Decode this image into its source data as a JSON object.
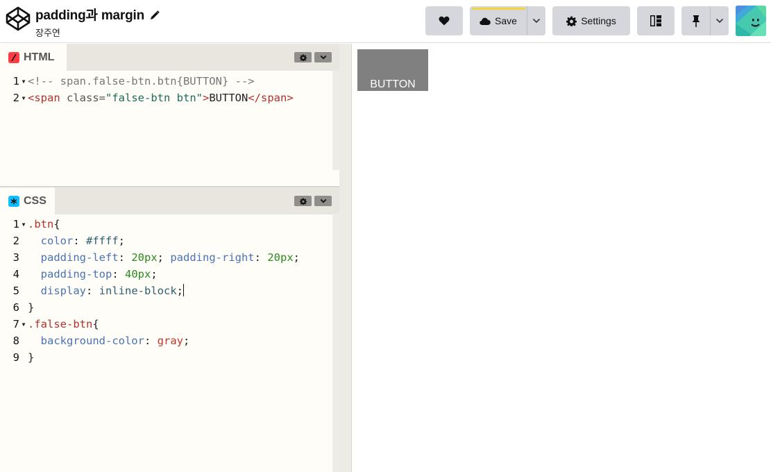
{
  "header": {
    "pen_title": "padding과 margin",
    "author": "장주연",
    "save_label": "Save",
    "settings_label": "Settings"
  },
  "html_pane": {
    "tab_label": "HTML",
    "lines": [
      {
        "num": "1",
        "fold": true,
        "parts": [
          {
            "t": "<!-- span.false-btn.btn{BUTTON} -->",
            "c": "c-comment"
          }
        ]
      },
      {
        "num": "2",
        "fold": true,
        "parts": [
          {
            "t": "<",
            "c": "c-tag"
          },
          {
            "t": "span",
            "c": "c-tag"
          },
          {
            "t": " class",
            "c": "c-attr"
          },
          {
            "t": "=",
            "c": "c-attr"
          },
          {
            "t": "\"false-btn btn\"",
            "c": "c-str"
          },
          {
            "t": ">",
            "c": "c-tag"
          },
          {
            "t": "BUTTON",
            "c": ""
          },
          {
            "t": "</",
            "c": "c-tag"
          },
          {
            "t": "span",
            "c": "c-tag"
          },
          {
            "t": ">",
            "c": "c-tag"
          }
        ]
      }
    ]
  },
  "css_pane": {
    "tab_label": "CSS",
    "lines": [
      {
        "num": "1",
        "fold": true,
        "parts": [
          {
            "t": ".btn",
            "c": "c-sel"
          },
          {
            "t": "{",
            "c": ""
          }
        ]
      },
      {
        "num": "2",
        "fold": false,
        "parts": [
          {
            "t": "  color",
            "c": "c-prop"
          },
          {
            "t": ": ",
            "c": ""
          },
          {
            "t": "#ffff",
            "c": "c-val"
          },
          {
            "t": ";",
            "c": ""
          }
        ]
      },
      {
        "num": "3",
        "fold": false,
        "parts": [
          {
            "t": "  padding-left",
            "c": "c-prop"
          },
          {
            "t": ": ",
            "c": ""
          },
          {
            "t": "20px",
            "c": "c-num"
          },
          {
            "t": "; ",
            "c": ""
          },
          {
            "t": "padding-right",
            "c": "c-prop"
          },
          {
            "t": ": ",
            "c": ""
          },
          {
            "t": "20px",
            "c": "c-num"
          },
          {
            "t": ";",
            "c": ""
          }
        ]
      },
      {
        "num": "4",
        "fold": false,
        "parts": [
          {
            "t": "  padding-top",
            "c": "c-prop"
          },
          {
            "t": ": ",
            "c": ""
          },
          {
            "t": "40px",
            "c": "c-num"
          },
          {
            "t": ";",
            "c": ""
          }
        ]
      },
      {
        "num": "5",
        "fold": false,
        "caret": true,
        "parts": [
          {
            "t": "  display",
            "c": "c-prop"
          },
          {
            "t": ": ",
            "c": ""
          },
          {
            "t": "inline-block",
            "c": "c-val"
          },
          {
            "t": ";",
            "c": ""
          }
        ]
      },
      {
        "num": "6",
        "fold": false,
        "parts": [
          {
            "t": "}",
            "c": ""
          }
        ]
      },
      {
        "num": "7",
        "fold": true,
        "parts": [
          {
            "t": ".false-btn",
            "c": "c-sel"
          },
          {
            "t": "{",
            "c": ""
          }
        ]
      },
      {
        "num": "8",
        "fold": false,
        "parts": [
          {
            "t": "  background-color",
            "c": "c-prop"
          },
          {
            "t": ": ",
            "c": ""
          },
          {
            "t": "gray",
            "c": "c-kw"
          },
          {
            "t": ";",
            "c": ""
          }
        ]
      },
      {
        "num": "9",
        "fold": false,
        "parts": [
          {
            "t": "}",
            "c": ""
          }
        ]
      }
    ]
  },
  "preview": {
    "button_text": "BUTTON"
  },
  "colors": {
    "html_badge": "#ff3c41",
    "css_badge": "#0ebeff",
    "save_progress": "#f5d33a",
    "preview_button_bg": "#808080"
  },
  "icons": {
    "logo": "codepen-logo-icon",
    "edit": "pencil-icon",
    "heart": "heart-icon",
    "save": "cloud-icon",
    "settings": "gear-icon",
    "layout": "layout-columns-icon",
    "pin": "pin-icon"
  }
}
